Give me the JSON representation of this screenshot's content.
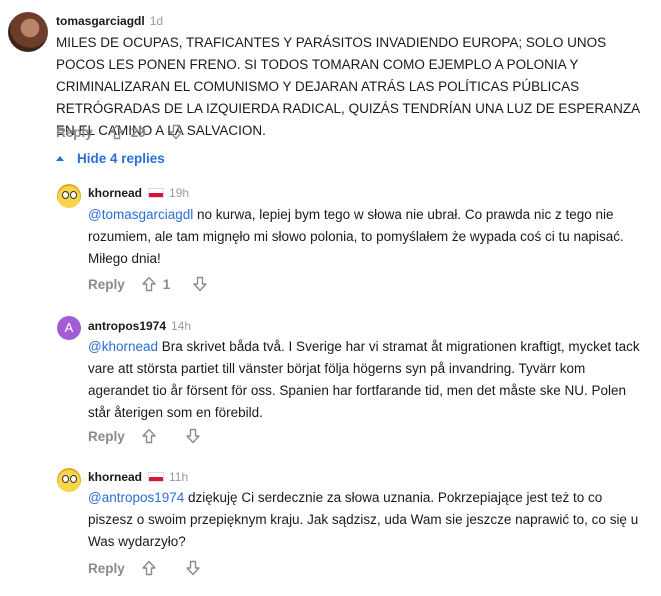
{
  "comments": [
    {
      "author": "tomasgarciagdl",
      "time": "1d",
      "avatar": "photo",
      "text": "MILES DE OCUPAS, TRAFICANTES Y PARÁSITOS INVADIENDO EUROPA; SOLO UNOS POCOS LES PONEN FRENO. SI TODOS TOMARAN COMO EJEMPLO A POLONIA Y CRIMINALIZARAN EL COMUNISMO Y DEJARAN ATRÁS LAS POLÍTICAS PÚBLICAS RETRÓGRADAS DE LA IZQUIERDA RADICAL, QUIZÁS TENDRÍAN UNA LUZ DE ESPERANZA EN EL CAMINO A LA SALVACION.",
      "reply_label": "Reply",
      "votes": "29"
    }
  ],
  "hide_replies_label": "Hide 4 replies",
  "replies": [
    {
      "author": "khornead",
      "flag": "poland-flag",
      "time": "19h",
      "mention": "@tomasgarciagdl",
      "text": " no kurwa, lepiej bym tego w słowa nie ubrał. Co prawda nic z tego nie rozumiem, ale tam mignęło mi słowo polonia, to pomyślałem że wypada coś ci tu napisać. Miłego dnia!",
      "reply_label": "Reply",
      "votes": "1"
    },
    {
      "author": "antropos1974",
      "avatar_letter": "A",
      "time": "14h",
      "mention": "@khornead",
      "text": " Bra skrivet båda två. I Sverige har vi stramat åt migrationen kraftigt, mycket tack vare att största partiet till vänster börjat följa högerns syn på invandring. Tyvärr kom agerandet tio år försent för oss. Spanien har fortfarande tid, men det måste ske NU. Polen står återigen som en förebild.",
      "reply_label": "Reply",
      "votes": ""
    },
    {
      "author": "khornead",
      "flag": "poland-flag",
      "time": "11h",
      "mention": "@antropos1974",
      "text": " dziękuję Ci serdecznie za słowa uznania. Pokrzepiające jest też to co piszesz o swoim przepięknym kraju. Jak sądzisz, uda Wam sie jeszcze naprawić to, co się u Was wydarzyło?",
      "reply_label": "Reply",
      "votes": ""
    }
  ],
  "colors": {
    "link": "#2a6fd6",
    "muted": "#8a8a8a",
    "flag_red": "#dc143c"
  }
}
